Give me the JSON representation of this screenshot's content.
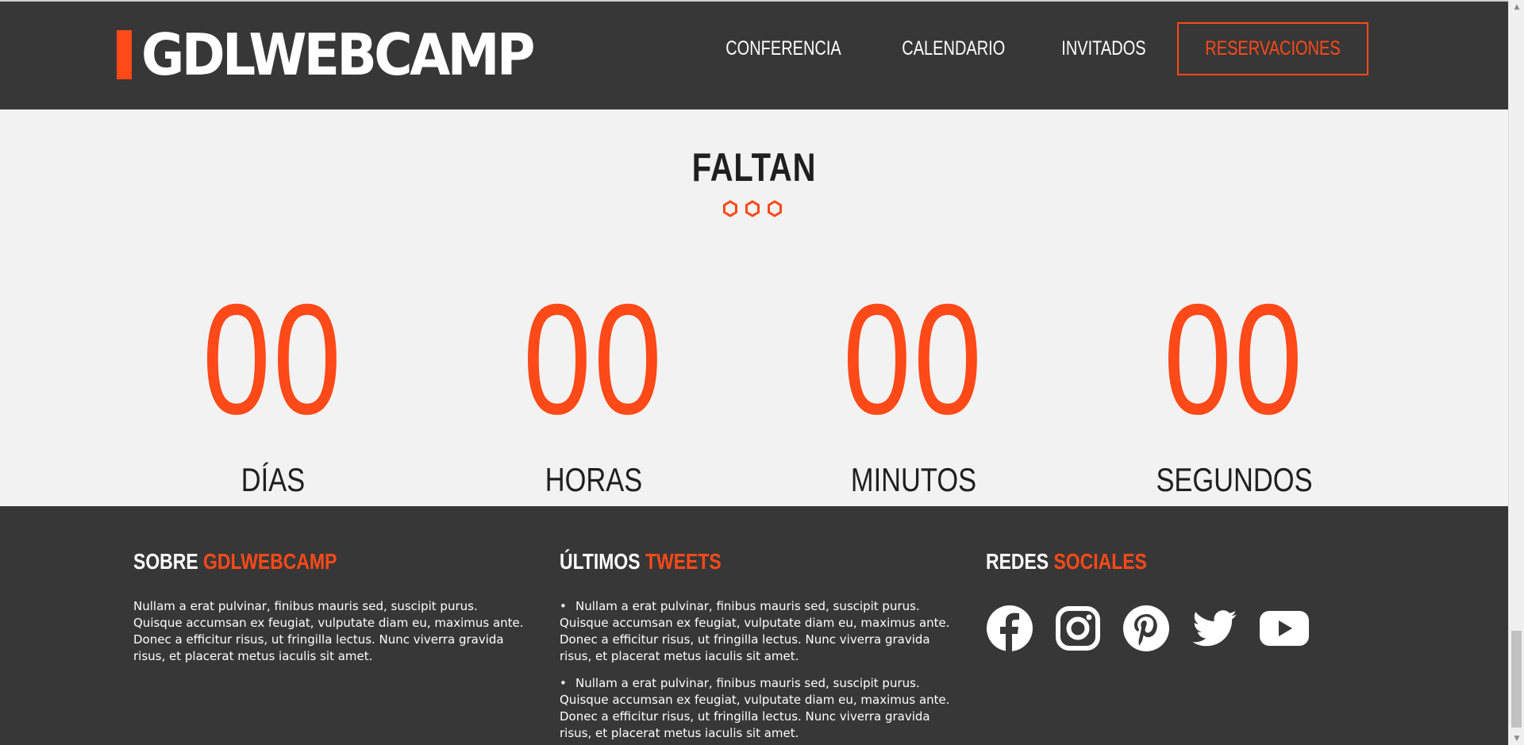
{
  "header": {
    "logo": "GDLWEBCAMP",
    "nav": [
      {
        "label": "CONFERENCIA"
      },
      {
        "label": "CALENDARIO"
      },
      {
        "label": "INVITADOS"
      },
      {
        "label": "RESERVACIONES"
      }
    ]
  },
  "countdown": {
    "title": "FALTAN",
    "items": [
      {
        "value": "00",
        "label": "DÍAS"
      },
      {
        "value": "00",
        "label": "HORAS"
      },
      {
        "value": "00",
        "label": "MINUTOS"
      },
      {
        "value": "00",
        "label": "SEGUNDOS"
      }
    ]
  },
  "footer": {
    "about": {
      "title_main": "SOBRE",
      "title_accent": "GDLWEBCAMP",
      "text": "Nullam a erat pulvinar, finibus mauris sed, suscipit purus. Quisque accumsan ex feugiat, vulputate diam eu, maximus ante. Donec a efficitur risus, ut fringilla lectus. Nunc viverra gravida risus, et placerat metus iaculis sit amet."
    },
    "tweets": {
      "title_main": "ÚLTIMOS",
      "title_accent": "TWEETS",
      "items": [
        "Nullam a erat pulvinar, finibus mauris sed, suscipit purus. Quisque accumsan ex feugiat, vulputate diam eu, maximus ante. Donec a efficitur risus, ut fringilla lectus. Nunc viverra gravida risus, et placerat metus iaculis sit amet.",
        "Nullam a erat pulvinar, finibus mauris sed, suscipit purus. Quisque accumsan ex feugiat, vulputate diam eu, maximus ante. Donec a efficitur risus, ut fringilla lectus. Nunc viverra gravida risus, et placerat metus iaculis sit amet."
      ]
    },
    "social": {
      "title_main": "REDES",
      "title_accent": "SOCIALES",
      "icons": [
        "facebook-icon",
        "instagram-icon",
        "pinterest-icon",
        "twitter-icon",
        "youtube-icon"
      ]
    }
  },
  "colors": {
    "accent": "#fe4918",
    "dark": "#373737",
    "light": "#f2f2f2"
  },
  "scrollbar": {
    "up_arrow": "▲",
    "down_arrow": "▼"
  }
}
